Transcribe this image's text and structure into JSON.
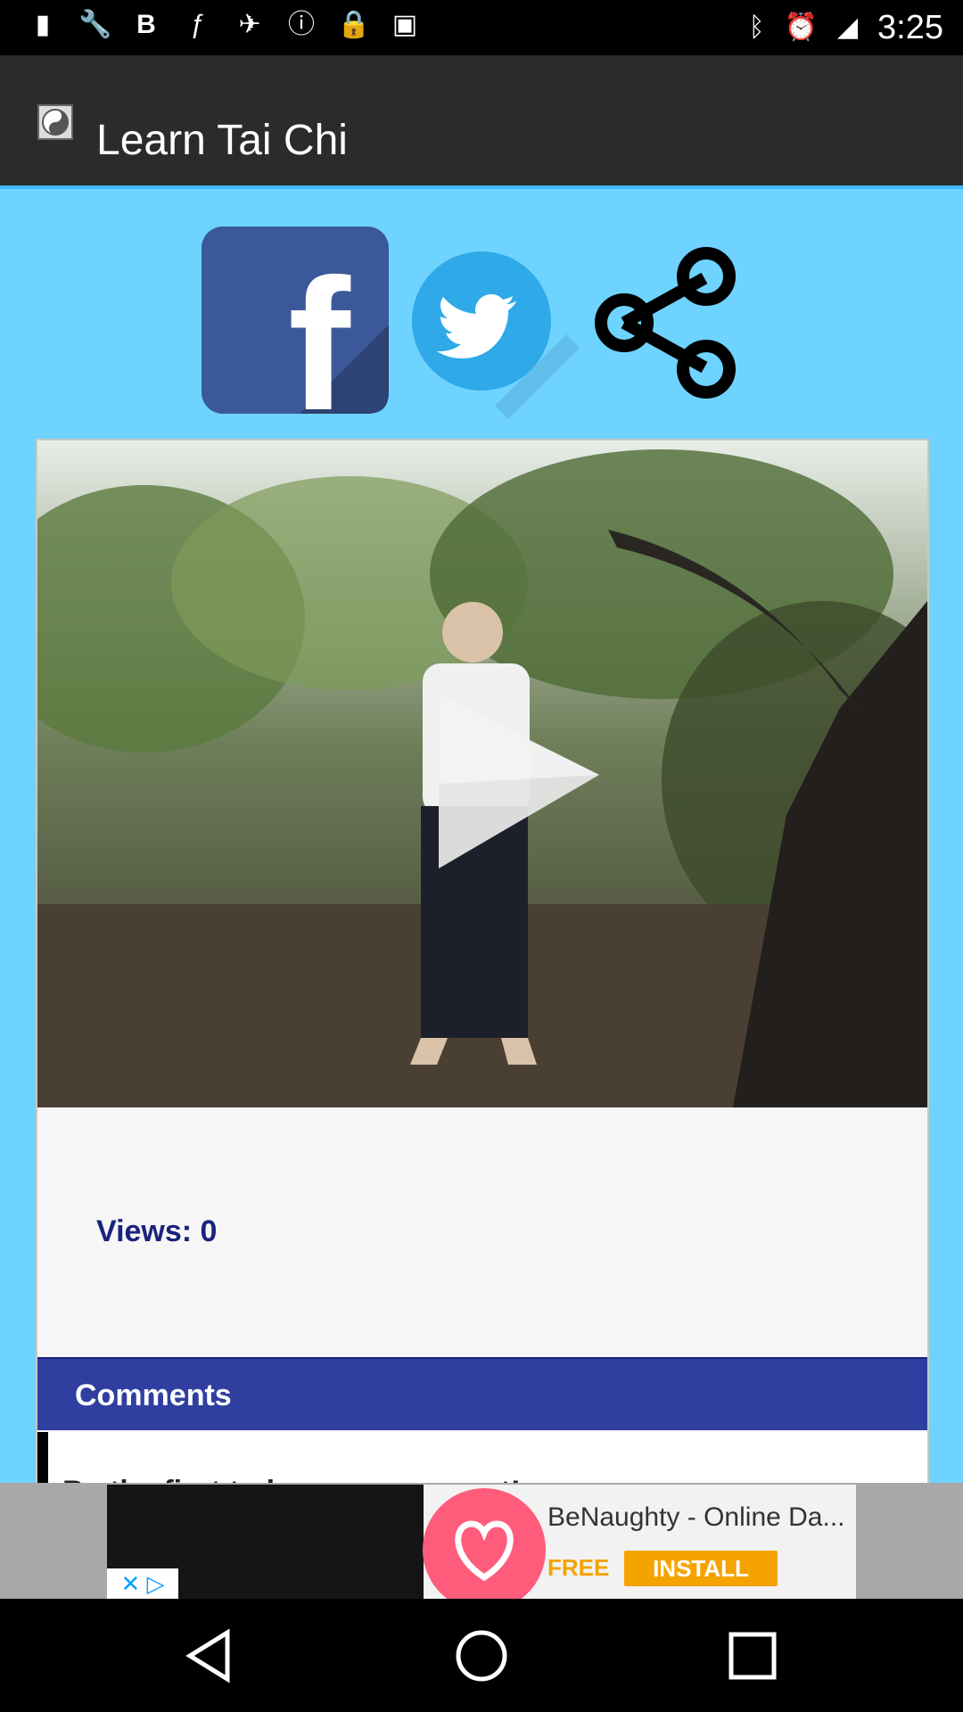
{
  "status_bar": {
    "time": "3:25",
    "icons": [
      "notification-icon",
      "wrench-icon",
      "bold-b-icon",
      "music-icon",
      "fake-gps-icon",
      "info-icon",
      "lock-icon",
      "android-icon",
      "bluetooth-icon",
      "alarm-icon",
      "signal-icon"
    ]
  },
  "app_bar": {
    "title": "Learn Tai Chi",
    "logo_icon": "yin-yang-icon"
  },
  "social": {
    "facebook_letter": "f",
    "share_icon": "share-icon"
  },
  "video": {
    "play_icon": "play-icon"
  },
  "stats": {
    "views_label": "Views: 0"
  },
  "comments": {
    "header": "Comments",
    "first_comment_partial": "Be the first to leave a comment!"
  },
  "ad": {
    "title": "BeNaughty - Online Da...",
    "free_label": "FREE",
    "install_label": "INSTALL",
    "close_icon": "ad-close-icon"
  },
  "colors": {
    "appbar": "#2b2b2d",
    "content_bg": "#6ed3ff",
    "comments_bar": "#303f9f",
    "views_text": "#1a237e",
    "accent": "#42b8ff"
  }
}
